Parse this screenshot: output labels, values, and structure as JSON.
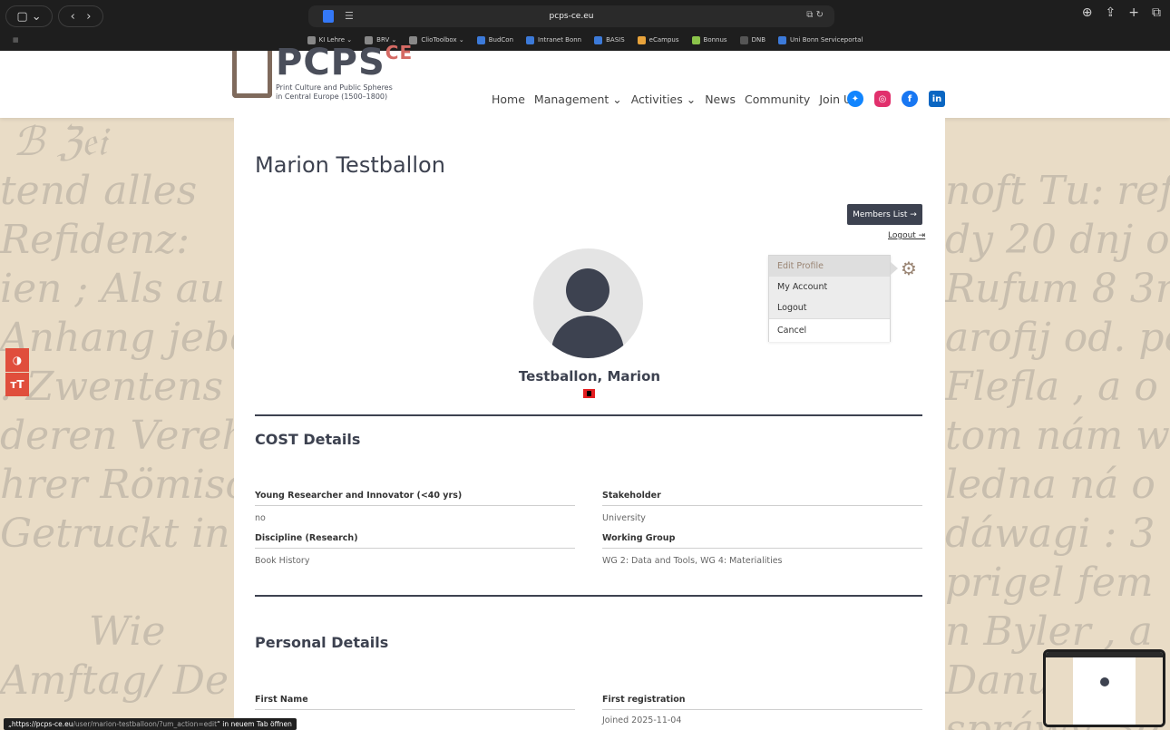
{
  "browser": {
    "url": "pcps-ce.eu",
    "bookmarks": [
      {
        "label": "KI Lehre ⌄",
        "color": "#888888"
      },
      {
        "label": "BRV ⌄",
        "color": "#888888"
      },
      {
        "label": "ClioToolbox ⌄",
        "color": "#888888"
      },
      {
        "label": "BudCon",
        "color": "#3c7ad9"
      },
      {
        "label": "Intranet Bonn",
        "color": "#3c7ad9"
      },
      {
        "label": "BASIS",
        "color": "#3c7ad9"
      },
      {
        "label": "eCampus",
        "color": "#e8a33b"
      },
      {
        "label": "Bonnus",
        "color": "#8bc34a"
      },
      {
        "label": "DNB",
        "color": "#555555"
      },
      {
        "label": "Uni Bonn Serviceportal",
        "color": "#3c7ad9"
      }
    ],
    "status_url_prefix": "„https://pcps-ce.eu",
    "status_url_path": "/user/marion-testballoon/?um_action=edit",
    "status_suffix": "“ in neuem Tab öffnen"
  },
  "site": {
    "logo_word": "PCPS",
    "logo_ce": "CE",
    "logo_sub1": "Print Culture and Public Spheres",
    "logo_sub2": "in Central Europe (1500–1800)",
    "nav": [
      "Home",
      "Management ⌄",
      "Activities ⌄",
      "News",
      "Community",
      "Join Us"
    ],
    "social_colors": {
      "bluesky": "#1185fe",
      "instagram": "#e1306c",
      "facebook": "#1877f2",
      "linkedin": "#0a66c2"
    }
  },
  "profile": {
    "page_title": "Marion Testballon",
    "members_list": "Members List →",
    "logout": "Logout ⇥",
    "display_name": "Testballon, Marion",
    "menu": [
      "Edit Profile",
      "My Account",
      "Logout",
      "Cancel"
    ]
  },
  "cost": {
    "title": "COST Details",
    "fields": [
      {
        "label": "Young Researcher and Innovator (<40 yrs)",
        "value": "no"
      },
      {
        "label": "Stakeholder",
        "value": "University"
      },
      {
        "label": "Discipline (Research)",
        "value": "Book History"
      },
      {
        "label": "Working Group",
        "value": "WG 2: Data and Tools, WG 4: Materialities"
      }
    ]
  },
  "personal": {
    "title": "Personal Details",
    "fields": [
      {
        "label": "First Name",
        "value": ""
      },
      {
        "label": "First registration",
        "value": "Joined 2025-11-04"
      }
    ]
  }
}
